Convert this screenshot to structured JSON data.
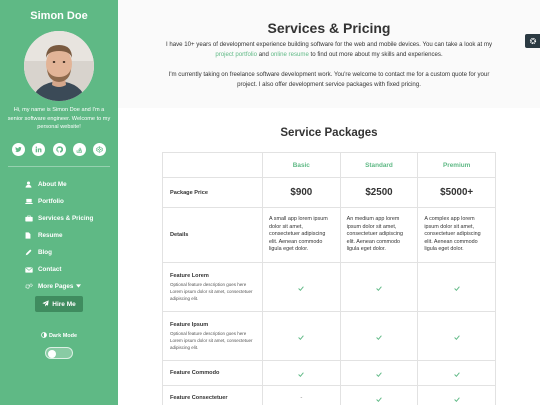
{
  "sidebar": {
    "name": "Simon Doe",
    "bio": "Hi, my name is Simon Doe and I'm a senior software engineer. Welcome to my personal website!",
    "socials": [
      "twitter-icon",
      "linkedin-icon",
      "github-icon",
      "stack-overflow-icon",
      "codepen-icon"
    ],
    "nav": [
      {
        "label": "About Me",
        "icon": "user-icon"
      },
      {
        "label": "Portfolio",
        "icon": "laptop-icon"
      },
      {
        "label": "Services & Pricing",
        "icon": "briefcase-icon"
      },
      {
        "label": "Resume",
        "icon": "file-icon"
      },
      {
        "label": "Blog",
        "icon": "blog-icon"
      },
      {
        "label": "Contact",
        "icon": "envelope-icon"
      },
      {
        "label": "More Pages",
        "icon": "cogs-icon"
      }
    ],
    "hire_label": "Hire Me",
    "dark_mode_label": "Dark Mode"
  },
  "header": {
    "title": "Services & Pricing",
    "intro_1_before": "I have 10+ years of development experience building software for the web and mobile devices. You can take a look at my ",
    "intro_1_link1": "project portfolio",
    "intro_1_mid": " and ",
    "intro_1_link2": "online resume",
    "intro_1_after": " to find out more about my skills and experiences.",
    "intro_2": "I'm currently taking on freelance software development work. You're welcome to contact me for a custom quote for your project. I also offer development service packages with fixed pricing."
  },
  "packages": {
    "title": "Service Packages",
    "columns": [
      "Basic",
      "Standard",
      "Premium"
    ],
    "price_label": "Package Price",
    "prices": [
      "$900",
      "$2500",
      "$5000+"
    ],
    "details_label": "Details",
    "details": [
      "A small app lorem ipsum dolor sit amet, consectetuer adipiscing elit. Aenean commodo ligula eget dolor.",
      "An medium app lorem ipsum dolor sit amet, consectetuer adipiscing elit. Aenean commodo ligula eget dolor.",
      "A complex app lorem ipsum dolor sit amet, consectetuer adipiscing elit. Aenean commodo ligula eget dolor."
    ],
    "features": [
      {
        "name": "Feature Lorem",
        "desc": "Optional feature description goes here Lorem ipsum dolor sit amet, consectetuer adipiscing elit.",
        "values": [
          true,
          true,
          true
        ]
      },
      {
        "name": "Feature Ipsum",
        "desc": "Optional feature description goes here Lorem ipsum dolor sit amet, consectetuer adipiscing elit.",
        "values": [
          true,
          true,
          true
        ]
      },
      {
        "name": "Feature Commodo",
        "desc": "",
        "values": [
          true,
          true,
          true
        ]
      },
      {
        "name": "Feature Consectetuer",
        "desc": "",
        "values": [
          false,
          true,
          true
        ]
      }
    ],
    "dash": "-"
  },
  "colors": {
    "accent": "#5fb985",
    "accent_dark": "#3f8c5f",
    "text": "#292929"
  }
}
